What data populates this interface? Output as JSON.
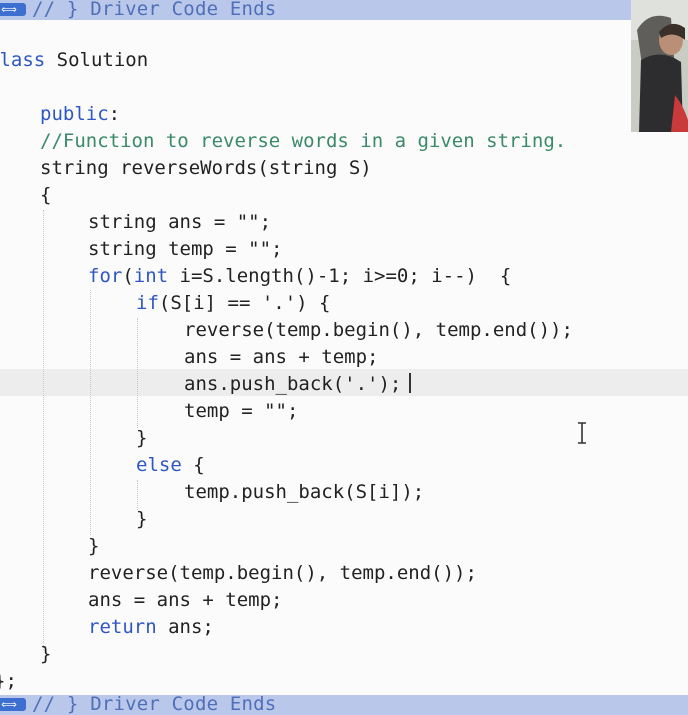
{
  "fold_top": {
    "icon": "⟺",
    "text": "// } Driver Code Ends"
  },
  "fold_bottom": {
    "icon": "⟺",
    "text": "// } Driver Code Ends"
  },
  "code": {
    "l1": {
      "kw": "class",
      "rest": " Solution"
    },
    "l2": "{",
    "l3": {
      "kw": "public",
      "rest": ":"
    },
    "l4": "//Function to reverse words in a given string.",
    "l5": "string reverseWords(string S)",
    "l6": "{",
    "l7": "string ans = \"\";",
    "l8": "string temp = \"\";",
    "l9": {
      "kw": "for",
      "mid": "(",
      "kw2": "int",
      "rest": " i=S.length()-1; i>=0; i--)  {"
    },
    "l10": {
      "kw": "if",
      "rest": "(S[i] == '.') {"
    },
    "l11": "reverse(temp.begin(), temp.end());",
    "l12": "ans = ans + temp;",
    "l13": "ans.push_back('.');",
    "l14": "temp = \"\";",
    "l15": "}",
    "l16": {
      "kw": "else",
      "rest": " {"
    },
    "l17": "temp.push_back(S[i]);",
    "l18": "}",
    "l19": "}",
    "l20": "reverse(temp.begin(), temp.end());",
    "l21": "ans = ans + temp;",
    "l22": {
      "kw": "return",
      "rest": " ans;"
    },
    "l23": "}",
    "l24": "};"
  },
  "colors": {
    "keyword": "#2f57c4",
    "comment": "#3a8a6a",
    "fold_bar": "#b9c8ea",
    "current_line": "#ededed"
  }
}
